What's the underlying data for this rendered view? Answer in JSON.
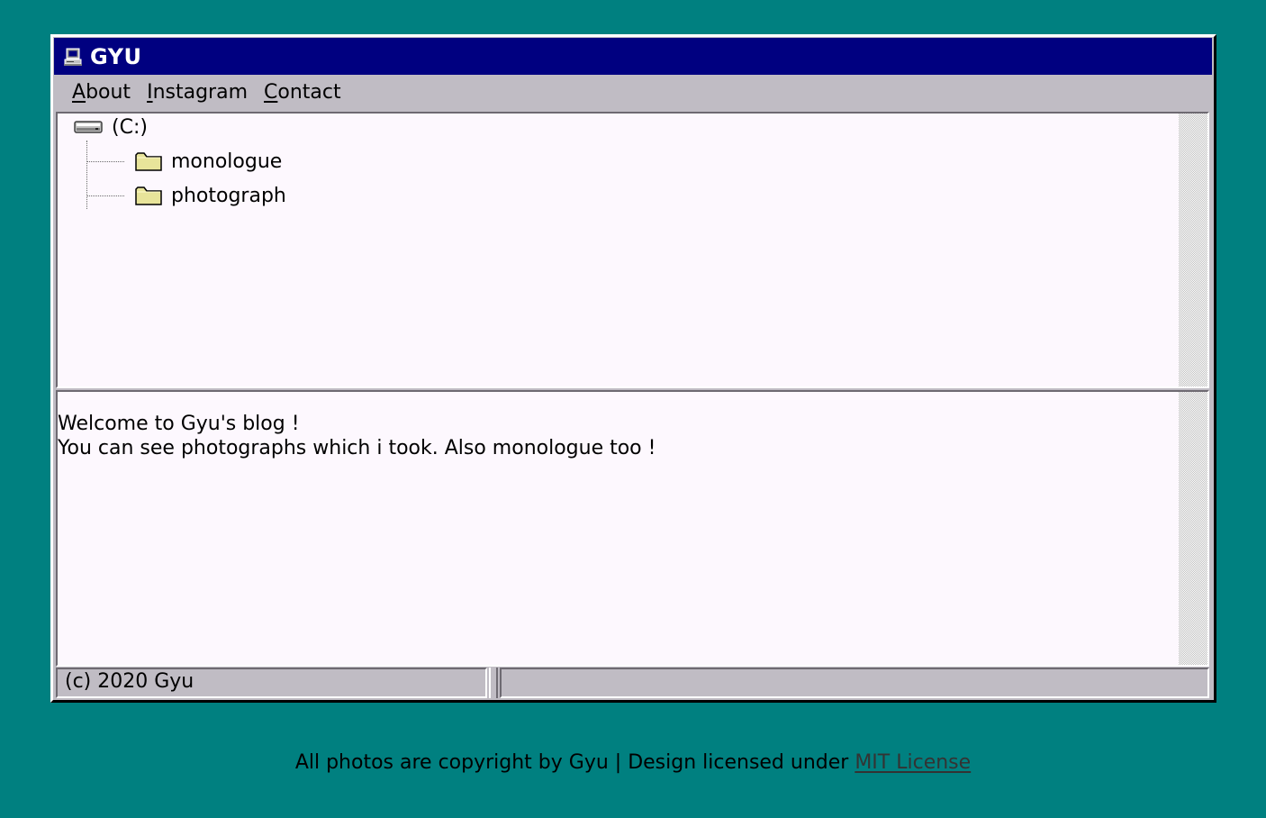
{
  "window": {
    "title": "GYU",
    "title_icon": "computer-icon"
  },
  "menu": {
    "items": [
      {
        "accel": "A",
        "rest": "bout"
      },
      {
        "accel": "I",
        "rest": "nstagram"
      },
      {
        "accel": "C",
        "rest": "ontact"
      }
    ]
  },
  "tree": {
    "root": {
      "label": "(C:)",
      "icon": "drive-icon"
    },
    "children": [
      {
        "label": "monologue",
        "icon": "folder-icon"
      },
      {
        "label": "photograph",
        "icon": "folder-icon"
      }
    ]
  },
  "content": {
    "line1": "Welcome to Gyu's blog !",
    "line2": "You can see photographs which i took. Also monologue too !"
  },
  "statusbar": {
    "left": "(c) 2020 Gyu",
    "right": ""
  },
  "footer": {
    "text": "All photos are copyright by Gyu | Design licensed under ",
    "link": "MIT License"
  },
  "colors": {
    "desktop": "#008080",
    "titlebar": "#000080",
    "window": "#c0bcc4",
    "pane": "#fdf8fe",
    "folder": "#e8e49a"
  }
}
